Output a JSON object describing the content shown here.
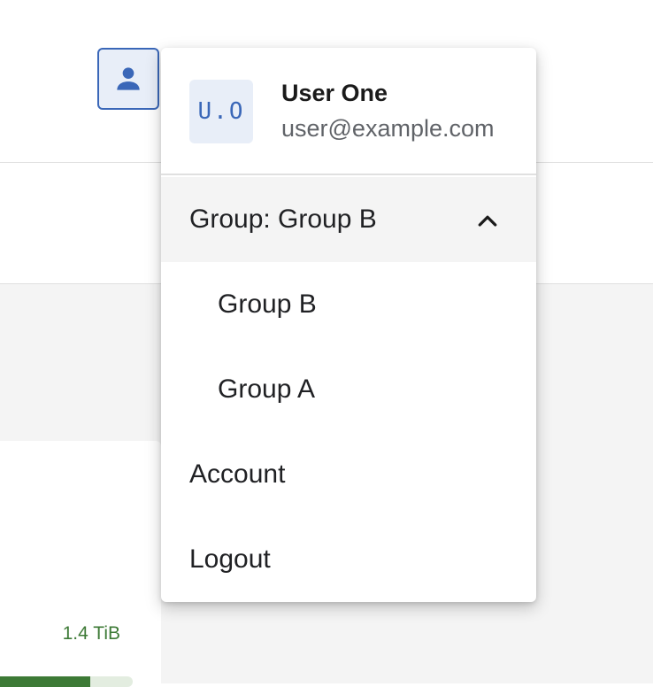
{
  "user": {
    "initials": "U.O",
    "name": "User One",
    "email": "user@example.com"
  },
  "user_button": {
    "icon": "person-icon"
  },
  "menu": {
    "group_toggle_label": "Group: Group B",
    "group_toggle_icon": "chevron-up-icon",
    "groups": [
      "Group B",
      "Group A"
    ],
    "account_label": "Account",
    "logout_label": "Logout"
  },
  "background": {
    "card_value": "1.4 TiB",
    "card_progress": 0.68
  },
  "colors": {
    "accent_blue": "#3a67b8",
    "storage_green": "#3d7a36"
  }
}
